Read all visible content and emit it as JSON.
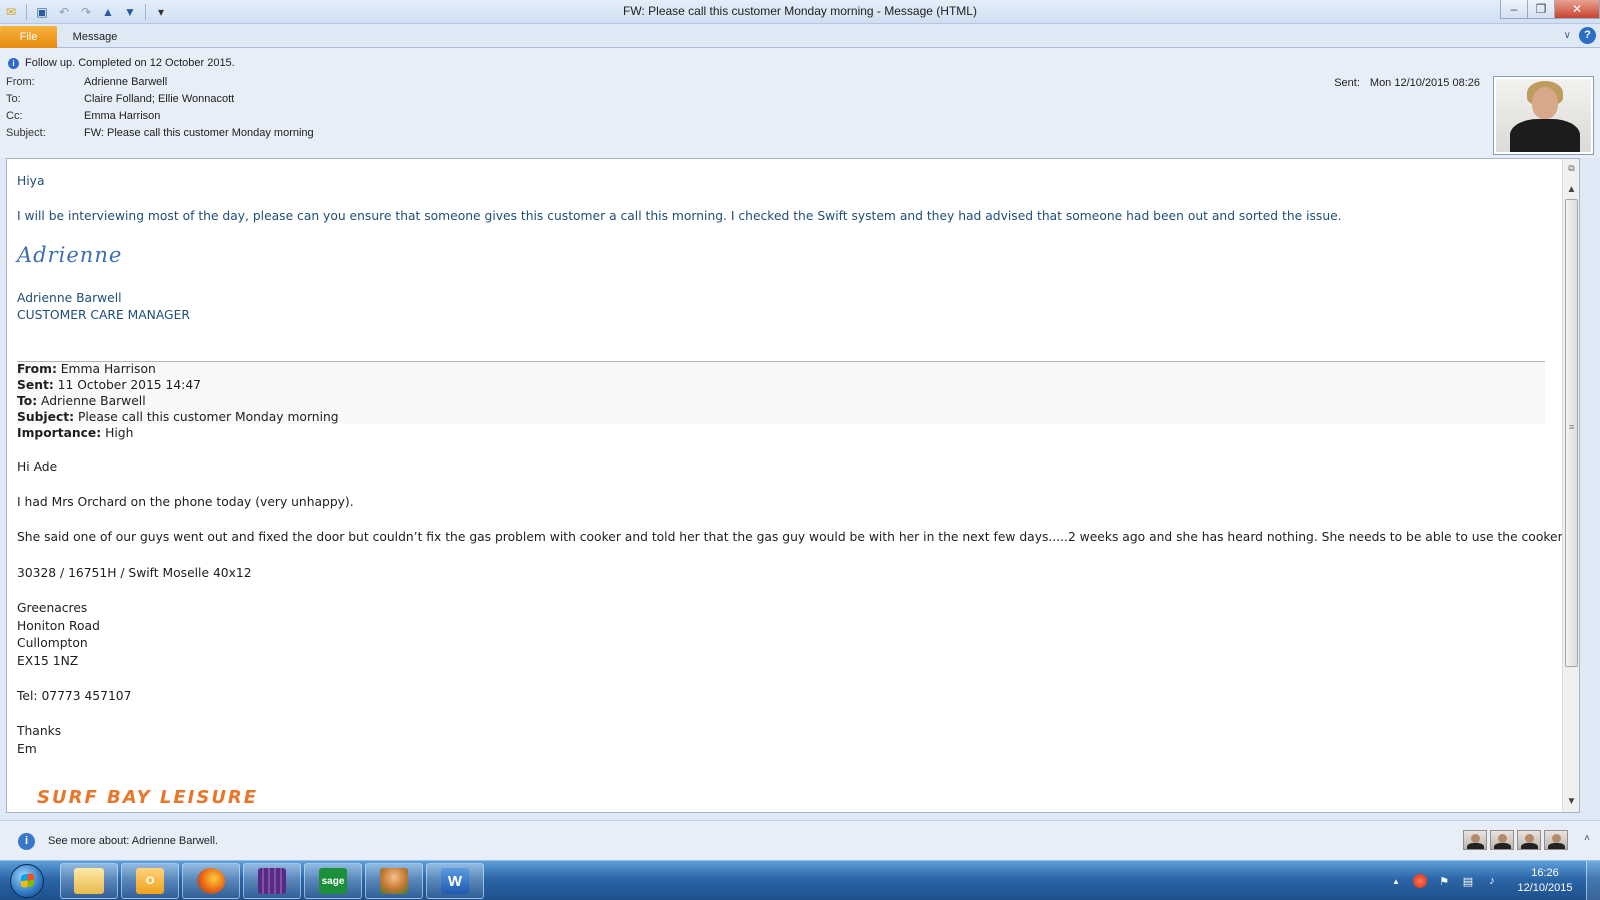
{
  "window": {
    "title": "FW: Please call this customer Monday morning  -  Message (HTML)",
    "controls": {
      "minimize": "–",
      "restore": "❐",
      "close": "✕"
    }
  },
  "qat": {
    "icons": [
      "envelope-icon",
      "save-icon",
      "undo-icon",
      "redo-icon",
      "previous-item-icon",
      "next-item-icon",
      "customize-qat-icon"
    ],
    "glyphs": {
      "envelope": "✉",
      "save": "▣",
      "undo": "↶",
      "redo": "↷",
      "prev": "▲",
      "next": "▼",
      "customize": "▾"
    }
  },
  "ribbon": {
    "tabs": [
      "File",
      "Message"
    ],
    "expand_glyph": "∨",
    "help_glyph": "?"
  },
  "header": {
    "info_glyph": "i",
    "follow_up": "Follow up.  Completed on 12 October 2015.",
    "from_label": "From:",
    "from_value": "Adrienne Barwell",
    "to_label": "To:",
    "to_value": "Claire Folland; Ellie Wonnacott",
    "cc_label": "Cc:",
    "cc_value": "Emma Harrison",
    "subject_label": "Subject:",
    "subject_value": "FW: Please call this customer Monday morning",
    "sent_label": "Sent:",
    "sent_value": "Mon 12/10/2015 08:26"
  },
  "body": {
    "greeting": "Hiya",
    "line1": "I will be interviewing most of the day, please can you ensure that someone gives this customer a call this morning.  I checked the Swift system and they had advised that someone had been out and sorted the issue.",
    "signature_script": "Adrienne",
    "signature_name": "Adrienne Barwell",
    "signature_title": "CUSTOMER CARE MANAGER",
    "fwd": {
      "from_label": "From:",
      "from_value": " Emma Harrison",
      "sent_label": "Sent:",
      "sent_value": " 11 October 2015 14:47",
      "to_label": "To:",
      "to_value": " Adrienne Barwell",
      "subject_label": "Subject:",
      "subject_value": " Please call this customer Monday morning",
      "importance_label": "Importance:",
      "importance_value": " High"
    },
    "fwd_greeting": "Hi Ade",
    "fwd_line1": "I had Mrs Orchard on the phone today (very unhappy).",
    "fwd_line2": "She said one of our guys went out and fixed the door but couldn’t fix the gas problem with cooker and told her that the gas guy would be with her in the next few days.....2 weeks ago and she has heard nothing.  She needs to be able to use the cooker.",
    "fwd_ref": "30328 / 16751H / Swift Moselle 40x12",
    "address": [
      "Greenacres",
      "Honiton Road",
      "Cullompton",
      "EX15 1NZ"
    ],
    "tel": "Tel: 07773 457107",
    "thanks": "Thanks",
    "sign_off": "Em",
    "logo_text": "SURF BAY LEISURE"
  },
  "scrollbar": {
    "up_glyph": "▲",
    "down_glyph": "▼",
    "grip_glyph": "≡",
    "expand_glyph": "⧉"
  },
  "people_pane": {
    "info_glyph": "i",
    "text": "See more about: Adrienne Barwell.",
    "toggle_glyph": "˄"
  },
  "taskbar": {
    "apps": [
      "windows-explorer",
      "outlook",
      "firefox",
      "calendar-app",
      "sage",
      "contacts-app",
      "word"
    ],
    "app_labels": {
      "outlook": "O",
      "sage": "sage",
      "word": "W"
    },
    "clock_time": "16:26",
    "clock_date": "12/10/2015",
    "tray_glyphs": {
      "arrow": "▲",
      "flag": "⚑",
      "network": "▤",
      "volume": "♪"
    }
  }
}
